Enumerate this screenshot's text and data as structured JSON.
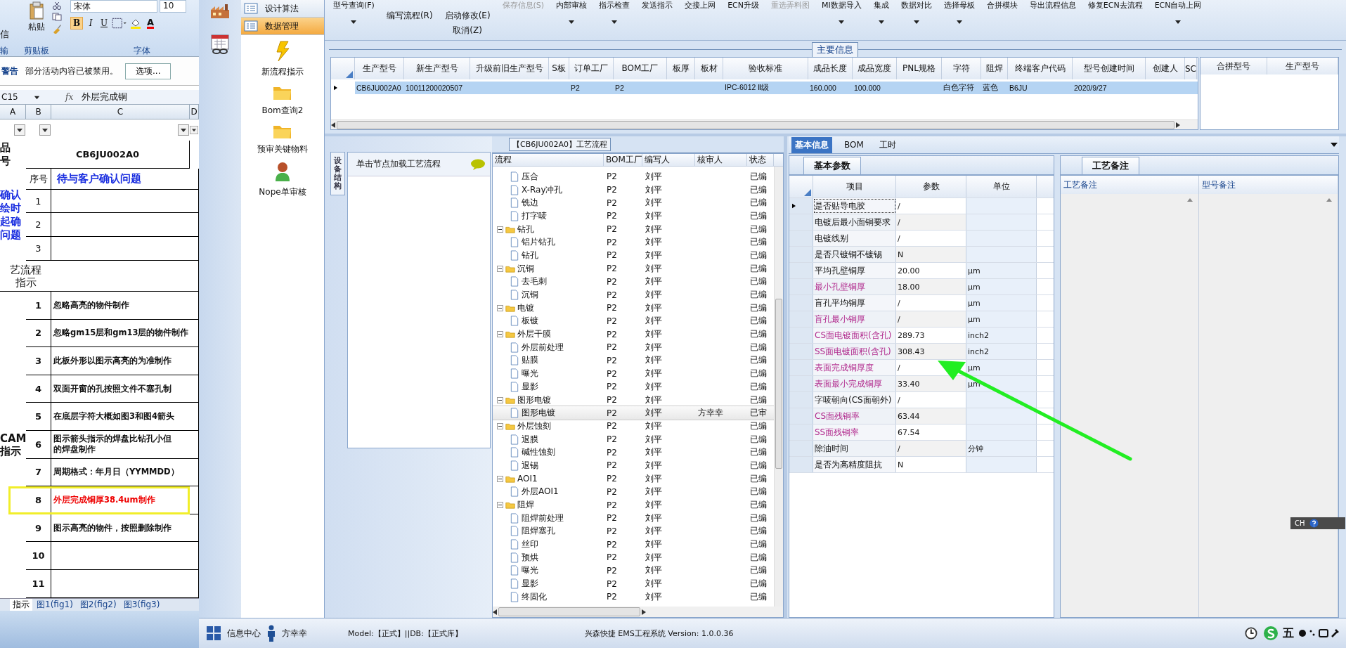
{
  "excel": {
    "ribbon": {
      "cut_left_label": "信",
      "paste_label": "粘贴",
      "font_name": "宋体",
      "font_size": "10",
      "format_buttons": [
        "B",
        "I",
        "U"
      ],
      "font_color": "A",
      "groups": [
        "剪贴板",
        "字体"
      ],
      "cut_group_label": "输"
    },
    "security_bar": {
      "title": "警告",
      "message": "部分活动内容已被禁用。",
      "button": "选项..."
    },
    "formula_bar": {
      "cell": "C15",
      "function_label": "fx",
      "value": "外层完成铜"
    },
    "columns": [
      "A",
      "B",
      "C",
      "D"
    ],
    "product_row": {
      "label": [
        "品",
        "号"
      ],
      "value": "CB6JU002A0"
    },
    "question_section": {
      "label": [
        "确认",
        "绘时",
        "起确",
        "问题"
      ],
      "index_header": "序号",
      "title": "待与客户确认问题",
      "rows": [
        "1",
        "2",
        "3"
      ]
    },
    "process_section": {
      "label": [
        "艺流程",
        "指示"
      ]
    },
    "cam_section": {
      "label": [
        "CAM",
        "指示"
      ],
      "rows": [
        {
          "index": "1",
          "text": "忽略高亮的物件制作",
          "highlighted": false
        },
        {
          "index": "2",
          "text": "忽略gm15层和gm13层的物件制作",
          "highlighted": false
        },
        {
          "index": "3",
          "text": "此板外形以图示高亮的为准制作",
          "highlighted": false
        },
        {
          "index": "4",
          "text": "双面开窗的孔按照文件不塞孔制",
          "highlighted": false
        },
        {
          "index": "5",
          "text": "在底层字符大概如图3和图4箭头",
          "highlighted": false
        },
        {
          "index": "6",
          "lines": [
            "图示箭头指示的焊盘比钻孔小但",
            "的焊盘制作"
          ],
          "highlighted": false
        },
        {
          "index": "7",
          "text": "周期格式：年月日（YYMMDD）",
          "highlighted": false
        },
        {
          "index": "8",
          "text": "外层完成铜厚38.4um制作",
          "highlighted": true
        },
        {
          "index": "9",
          "text": "图示高亮的物件，按照删除制作",
          "highlighted": false
        },
        {
          "index": "10",
          "highlighted": false
        },
        {
          "index": "11",
          "highlighted": false
        }
      ]
    },
    "sheet_tabs": [
      {
        "label": "指示",
        "selected": true
      },
      {
        "label": "图1(fig1)",
        "selected": false
      },
      {
        "label": "图2(fig2)",
        "selected": false
      },
      {
        "label": "图3(fig3)",
        "selected": false
      }
    ]
  },
  "nav": {
    "menu": [
      {
        "label": "设计算法",
        "selected": false
      },
      {
        "label": "数据管理",
        "selected": true
      }
    ],
    "actions": [
      {
        "label": "新流程指示",
        "kind": "lightning"
      },
      {
        "label": "Bom查询2",
        "kind": "folder"
      },
      {
        "label": "预审关键物料",
        "kind": "folder"
      },
      {
        "label": "Nope单审核",
        "kind": "person"
      }
    ]
  },
  "toolbar": [
    {
      "kind": "top",
      "label": "型号查询(F)",
      "dropdown": true,
      "disabled": false
    },
    {
      "kind": "stack",
      "labels": [
        "编写流程(R)"
      ]
    },
    {
      "kind": "stack",
      "labels": [
        "启动修改(E)",
        "取消(Z)"
      ]
    },
    {
      "kind": "top",
      "label": "保存信息(S)",
      "dropdown": false,
      "disabled": true
    },
    {
      "kind": "top",
      "label": "内部审核",
      "dropdown": true,
      "disabled": false
    },
    {
      "kind": "top",
      "label": "指示检查",
      "dropdown": true,
      "disabled": false
    },
    {
      "kind": "top",
      "label": "发送指示",
      "dropdown": false,
      "disabled": false
    },
    {
      "kind": "top",
      "label": "交接上网",
      "dropdown": false,
      "disabled": false
    },
    {
      "kind": "top",
      "label": "ECN升级",
      "dropdown": false,
      "disabled": false
    },
    {
      "kind": "top",
      "label": "重选弄料图",
      "dropdown": false,
      "disabled": true
    },
    {
      "kind": "top",
      "label": "MI数据导入",
      "dropdown": true,
      "disabled": false
    },
    {
      "kind": "top",
      "label": "集成",
      "dropdown": true,
      "disabled": false
    },
    {
      "kind": "top",
      "label": "数据对比",
      "dropdown": true,
      "disabled": false
    },
    {
      "kind": "top",
      "label": "选择母板",
      "dropdown": true,
      "disabled": false
    },
    {
      "kind": "top",
      "label": "合拼模块",
      "dropdown": false,
      "disabled": false
    },
    {
      "kind": "top",
      "label": "导出流程信息",
      "dropdown": false,
      "disabled": false
    },
    {
      "kind": "top",
      "label": "修复ECN去流程",
      "dropdown": false,
      "disabled": false
    },
    {
      "kind": "top",
      "label": "ECN自动上网",
      "dropdown": true,
      "disabled": false
    }
  ],
  "main_info": {
    "title": "主要信息",
    "columns": [
      "生产型号",
      "新生产型号",
      "升级前旧生产型号",
      "S板",
      "订单工厂",
      "BOM工厂",
      "板厚",
      "板材",
      "验收标准",
      "成品长度",
      "成品宽度",
      "PNL规格",
      "字符",
      "阻焊",
      "终端客户代码",
      "型号创建时间",
      "创建人",
      "SC"
    ],
    "rows": [
      {
        "selected": true,
        "cells": [
          "CB6JU002A0",
          "10011200020507",
          null,
          null,
          "P2",
          "P2",
          null,
          null,
          "IPC-6012 Ⅱ级",
          "160.000",
          "100.000",
          null,
          "白色字符",
          "蓝色",
          "B6JU",
          "2020/9/27",
          null,
          null
        ]
      }
    ],
    "side_columns": [
      "合拼型号",
      "生产型号"
    ]
  },
  "structure_panel": {
    "tabs": [
      {
        "label": "设备结构",
        "selected": true
      }
    ],
    "hint": "单击节点加载工艺流程"
  },
  "process_tree": {
    "title": "【CB6JU002A0】工艺流程",
    "columns": [
      "流程",
      "BOM工厂",
      "编写人",
      "核审人",
      "状态"
    ],
    "nodes": [
      {
        "children": [
          {
            "label": "压合",
            "bom": "P2",
            "author": "刘平",
            "status": "已编",
            "selected": false
          },
          {
            "label": "X-Ray冲孔",
            "bom": "P2",
            "author": "刘平",
            "status": "已编",
            "selected": false
          },
          {
            "label": "铣边",
            "bom": "P2",
            "author": "刘平",
            "status": "已编",
            "selected": false
          },
          {
            "label": "打字唛",
            "bom": "P2",
            "author": "刘平",
            "status": "已编",
            "selected": false
          }
        ]
      },
      {
        "label": "钻孔",
        "bom": "P2",
        "author": "刘平",
        "status": "已编",
        "selected": false,
        "expanded": true,
        "children": [
          {
            "label": "铝片钻孔",
            "bom": "P2",
            "author": "刘平",
            "status": "已编",
            "selected": false
          },
          {
            "label": "钻孔",
            "bom": "P2",
            "author": "刘平",
            "status": "已编",
            "selected": false
          }
        ]
      },
      {
        "label": "沉铜",
        "bom": "P2",
        "author": "刘平",
        "status": "已编",
        "selected": false,
        "expanded": true,
        "children": [
          {
            "label": "去毛刺",
            "bom": "P2",
            "author": "刘平",
            "status": "已编",
            "selected": false
          },
          {
            "label": "沉铜",
            "bom": "P2",
            "author": "刘平",
            "status": "已编",
            "selected": false
          }
        ]
      },
      {
        "label": "电镀",
        "bom": "P2",
        "author": "刘平",
        "status": "已编",
        "selected": false,
        "expanded": true,
        "children": [
          {
            "label": "板镀",
            "bom": "P2",
            "author": "刘平",
            "status": "已编",
            "selected": false
          }
        ]
      },
      {
        "label": "外层干膜",
        "bom": "P2",
        "author": "刘平",
        "status": "已编",
        "selected": false,
        "expanded": true,
        "children": [
          {
            "label": "外层前处理",
            "bom": "P2",
            "author": "刘平",
            "status": "已编",
            "selected": false
          },
          {
            "label": "贴膜",
            "bom": "P2",
            "author": "刘平",
            "status": "已编",
            "selected": false
          },
          {
            "label": "曝光",
            "bom": "P2",
            "author": "刘平",
            "status": "已编",
            "selected": false
          },
          {
            "label": "显影",
            "bom": "P2",
            "author": "刘平",
            "status": "已编",
            "selected": false
          }
        ]
      },
      {
        "label": "图形电镀",
        "bom": "P2",
        "author": "刘平",
        "status": "已编",
        "selected": false,
        "expanded": true,
        "children": [
          {
            "label": "图形电镀",
            "bom": "P2",
            "author": "刘平",
            "reviewer": "方幸幸",
            "status": "已审",
            "selected": true
          }
        ]
      },
      {
        "label": "外层蚀刻",
        "bom": "P2",
        "author": "刘平",
        "status": "已编",
        "selected": false,
        "expanded": true,
        "children": [
          {
            "label": "退膜",
            "bom": "P2",
            "author": "刘平",
            "status": "已编",
            "selected": false
          },
          {
            "label": "碱性蚀刻",
            "bom": "P2",
            "author": "刘平",
            "status": "已编",
            "selected": false
          },
          {
            "label": "退锡",
            "bom": "P2",
            "author": "刘平",
            "status": "已编",
            "selected": false
          }
        ]
      },
      {
        "label": "AOI1",
        "bom": "P2",
        "author": "刘平",
        "status": "已编",
        "selected": false,
        "expanded": true,
        "children": [
          {
            "label": "外层AOI1",
            "bom": "P2",
            "author": "刘平",
            "status": "已编",
            "selected": false
          }
        ]
      },
      {
        "label": "阻焊",
        "bom": "P2",
        "author": "刘平",
        "status": "已编",
        "selected": false,
        "expanded": true,
        "children": [
          {
            "label": "阻焊前处理",
            "bom": "P2",
            "author": "刘平",
            "status": "已编",
            "selected": false
          },
          {
            "label": "阻焊塞孔",
            "bom": "P2",
            "author": "刘平",
            "status": "已编",
            "selected": false
          },
          {
            "label": "丝印",
            "bom": "P2",
            "author": "刘平",
            "status": "已编",
            "selected": false
          },
          {
            "label": "预烘",
            "bom": "P2",
            "author": "刘平",
            "status": "已编",
            "selected": false
          },
          {
            "label": "曝光",
            "bom": "P2",
            "author": "刘平",
            "status": "已编",
            "selected": false
          },
          {
            "label": "显影",
            "bom": "P2",
            "author": "刘平",
            "status": "已编",
            "selected": false
          },
          {
            "label": "终固化",
            "bom": "P2",
            "author": "刘平",
            "status": "已编",
            "selected": false
          }
        ]
      }
    ]
  },
  "detail_tabs": [
    {
      "label": "基本信息",
      "selected": true
    },
    {
      "label": "BOM",
      "selected": false
    },
    {
      "label": "工时",
      "selected": false
    }
  ],
  "basic_params": {
    "title": "基本参数",
    "columns": [
      "项目",
      "参数",
      "单位"
    ],
    "rows": [
      {
        "item": "是否贴导电胶",
        "value": "/",
        "highlighted": false,
        "selected": true
      },
      {
        "item": "电镀后最小面铜要求",
        "value": "/",
        "highlighted": false,
        "selected": false
      },
      {
        "item": "电镀线别",
        "value": "/",
        "highlighted": false,
        "selected": false
      },
      {
        "item": "是否只镀铜不镀锡",
        "value": "N",
        "highlighted": false,
        "selected": false
      },
      {
        "item": "平均孔壁铜厚",
        "value": "20.00",
        "unit": "μm",
        "highlighted": false,
        "selected": false
      },
      {
        "item": "最小孔壁铜厚",
        "value": "18.00",
        "unit": "μm",
        "highlighted": true,
        "selected": false
      },
      {
        "item": "盲孔平均铜厚",
        "value": "/",
        "unit": "μm",
        "highlighted": false,
        "selected": false
      },
      {
        "item": "盲孔最小铜厚",
        "value": "/",
        "unit": "μm",
        "highlighted": true,
        "selected": false
      },
      {
        "item": "CS面电镀面积(含孔)",
        "value": "289.73",
        "unit": "inch2",
        "highlighted": true,
        "selected": false
      },
      {
        "item": "SS面电镀面积(含孔)",
        "value": "308.43",
        "unit": "inch2",
        "highlighted": true,
        "selected": false
      },
      {
        "item": "表面完成铜厚度",
        "value": "/",
        "unit": "μm",
        "highlighted": true,
        "selected": false
      },
      {
        "item": "表面最小完成铜厚",
        "value": "33.40",
        "unit": "μm",
        "highlighted": true,
        "selected": false
      },
      {
        "item": "字唛朝向(CS面朝外)",
        "value": "/",
        "highlighted": false,
        "selected": false
      },
      {
        "item": "CS面残铜率",
        "value": "63.44",
        "highlighted": true,
        "selected": false
      },
      {
        "item": "SS面残铜率",
        "value": "67.54",
        "highlighted": true,
        "selected": false
      },
      {
        "item": "除油时间",
        "value": "/",
        "unit": "分钟",
        "highlighted": false,
        "selected": false
      },
      {
        "item": "是否为高精度阻抗",
        "value": "N",
        "highlighted": false,
        "selected": false
      }
    ]
  },
  "remarks": {
    "title": "工艺备注",
    "columns": [
      "工艺备注",
      "型号备注"
    ]
  },
  "status_bar": {
    "info_center": "信息中心",
    "user": "方幸幸",
    "model": "Model:【正式】||DB:【正式库】",
    "version": "兴森快捷 EMS工程系统 Version: 1.0.0.36"
  },
  "tray": {
    "ime": "五",
    "language": "CH"
  }
}
